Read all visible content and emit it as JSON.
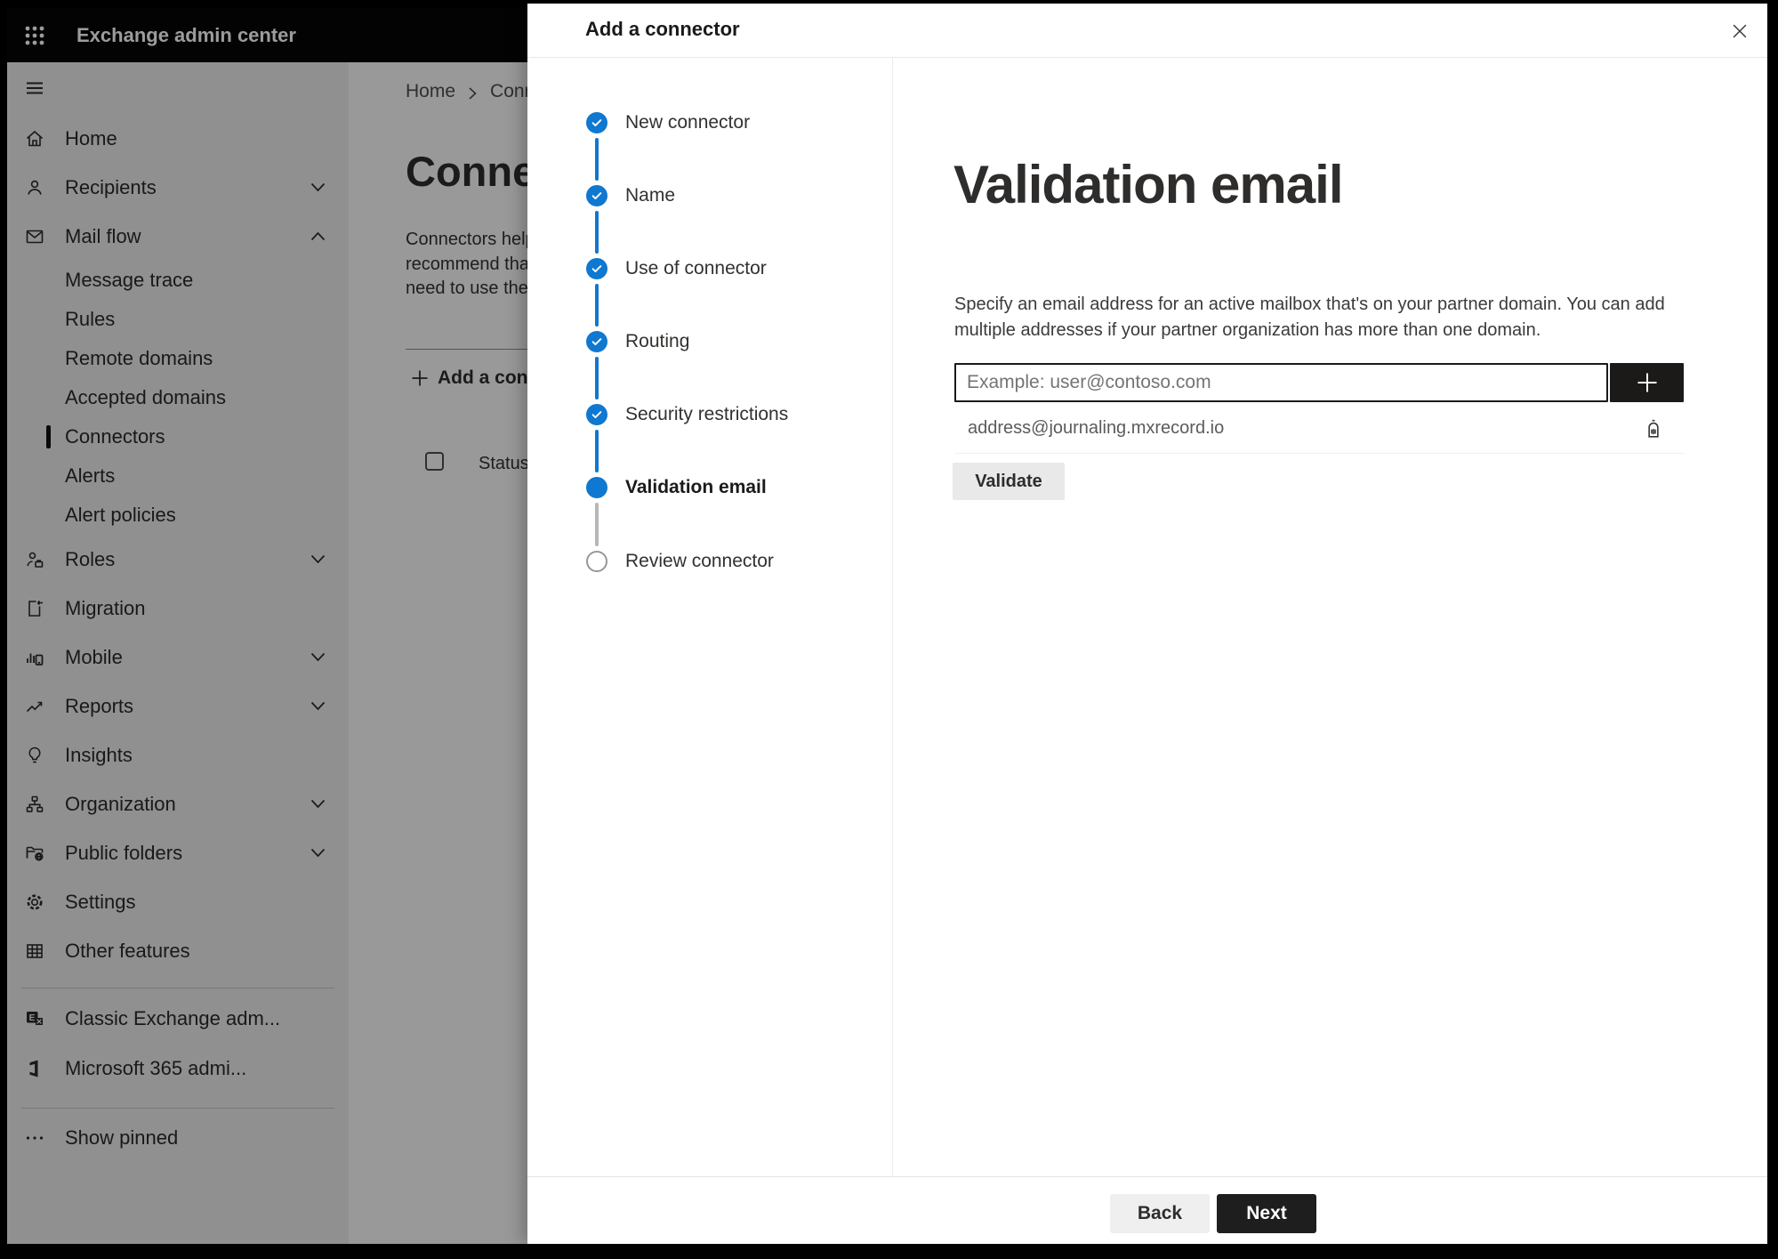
{
  "colors": {
    "accent_blue": "#0f78d0",
    "topbar_bg": "#050505",
    "sidebar_bg": "#ebebeb",
    "panel_bg": "#ffffff",
    "input_border": "#1b1a19",
    "add_button_bg": "#1b1a19",
    "validate_button_bg": "#e9e9e9",
    "next_button_bg": "#1f1e1e",
    "back_button_bg": "#efefef",
    "dim_overlay": "rgba(0,0,0,0.39)",
    "upcoming_step_border": "#9a9896"
  },
  "topbar": {
    "title": "Exchange admin center"
  },
  "sidebar": {
    "items": [
      {
        "label": "Home"
      },
      {
        "label": "Recipients"
      },
      {
        "label": "Mail flow"
      },
      {
        "label": "Roles"
      },
      {
        "label": "Migration"
      },
      {
        "label": "Mobile"
      },
      {
        "label": "Reports"
      },
      {
        "label": "Insights"
      },
      {
        "label": "Organization"
      },
      {
        "label": "Public folders"
      },
      {
        "label": "Settings"
      },
      {
        "label": "Other features"
      }
    ],
    "mailflow_children": [
      "Message trace",
      "Rules",
      "Remote domains",
      "Accepted domains",
      "Connectors",
      "Alerts",
      "Alert policies"
    ],
    "selected_item": "Connectors",
    "footer_links": [
      {
        "label": "Classic Exchange adm..."
      },
      {
        "label": "Microsoft 365 admi..."
      }
    ],
    "show_pinned_label": "Show pinned"
  },
  "background_page": {
    "breadcrumb_home": "Home",
    "breadcrumb_current": "Conne",
    "title_fragment": "Connec",
    "intro_line1": "Connectors help",
    "intro_line2": "recommend that",
    "intro_line3": "need to use ther",
    "add_connector_label": "Add a conn",
    "status_column_label": "Status"
  },
  "panel": {
    "title": "Add a connector",
    "steps": [
      {
        "label": "New connector",
        "state": "completed"
      },
      {
        "label": "Name",
        "state": "completed"
      },
      {
        "label": "Use of connector",
        "state": "completed"
      },
      {
        "label": "Routing",
        "state": "completed"
      },
      {
        "label": "Security restrictions",
        "state": "completed"
      },
      {
        "label": "Validation email",
        "state": "current"
      },
      {
        "label": "Review connector",
        "state": "upcoming"
      }
    ],
    "content": {
      "heading": "Validation email",
      "description_line1": "Specify an email address for an active mailbox that's on your partner domain. You can add",
      "description_line2": "multiple addresses if your partner organization has more than one domain.",
      "email_input": {
        "value": "",
        "placeholder": "Example: user@contoso.com"
      },
      "addresses": [
        {
          "email": "address@journaling.mxrecord.io"
        }
      ],
      "validate_button_label": "Validate"
    },
    "footer": {
      "back_label": "Back",
      "next_label": "Next"
    }
  }
}
